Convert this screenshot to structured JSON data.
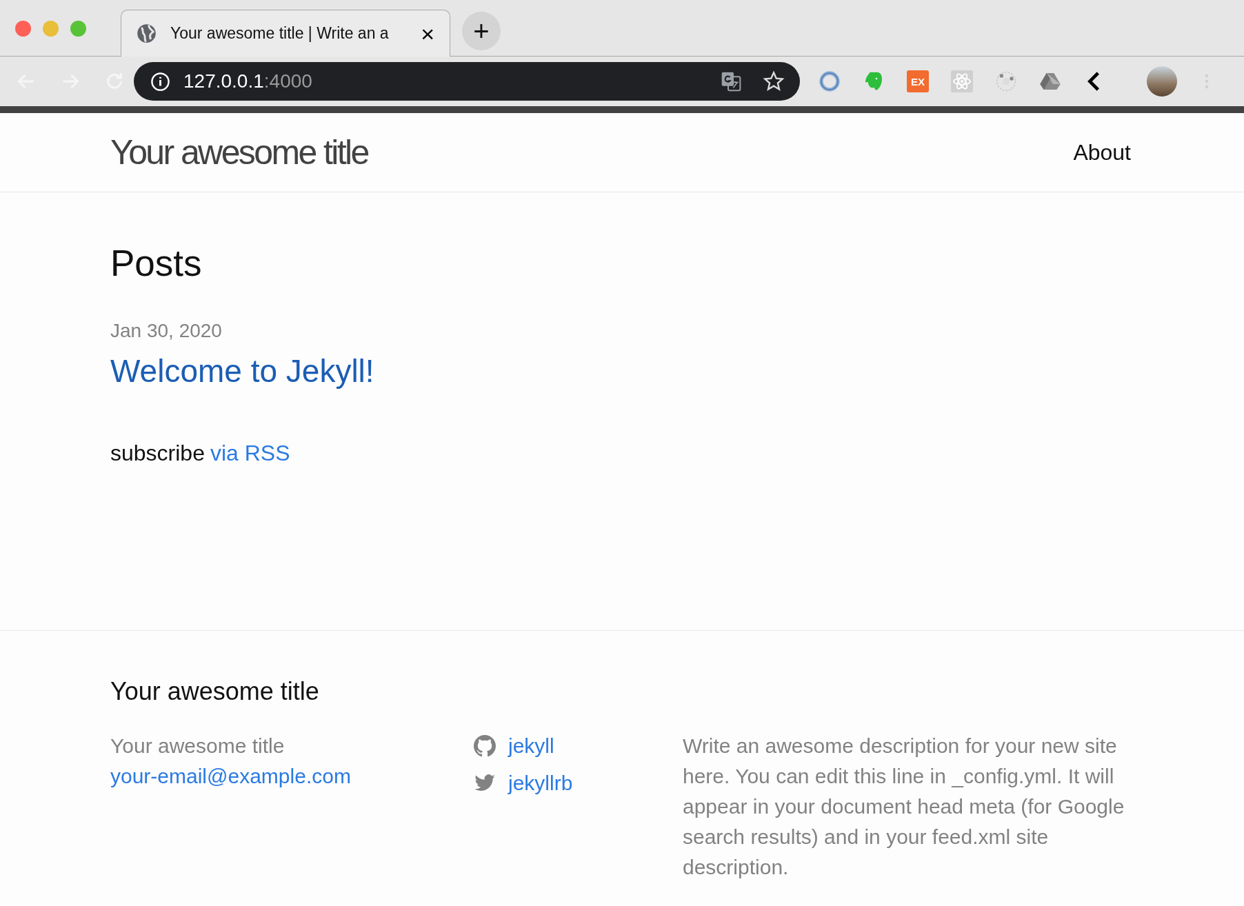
{
  "browser": {
    "tab": {
      "title": "Your awesome title | Write an a",
      "close": "×",
      "selected": true
    },
    "new_tab": "+",
    "address": {
      "host": "127.0.0.1",
      "port": ":4000"
    },
    "extensions": [
      {
        "kind": "ring"
      },
      {
        "kind": "elephant"
      },
      {
        "kind": "badge",
        "label": "EX"
      },
      {
        "kind": "atom"
      },
      {
        "kind": "target"
      },
      {
        "kind": "drive"
      },
      {
        "kind": "chevron"
      }
    ]
  },
  "header": {
    "site_title": "Your awesome title",
    "nav": [
      {
        "label": "About"
      }
    ]
  },
  "main": {
    "heading": "Posts",
    "posts": [
      {
        "date": "Jan 30, 2020",
        "title": "Welcome to Jekyll!"
      }
    ],
    "subscribe": {
      "text": "subscribe",
      "link": "via RSS"
    }
  },
  "footer": {
    "title": "Your awesome title",
    "contact": {
      "name": "Your awesome title",
      "email": "your-email@example.com"
    },
    "social": [
      {
        "kind": "github",
        "label": "jekyll"
      },
      {
        "kind": "twitter",
        "label": "jekyllrb"
      }
    ],
    "description": "Write an awesome description for your new site here. You can edit this line in _config.yml. It will appear in your document head meta (for Google search results) and in your feed.xml site description."
  }
}
